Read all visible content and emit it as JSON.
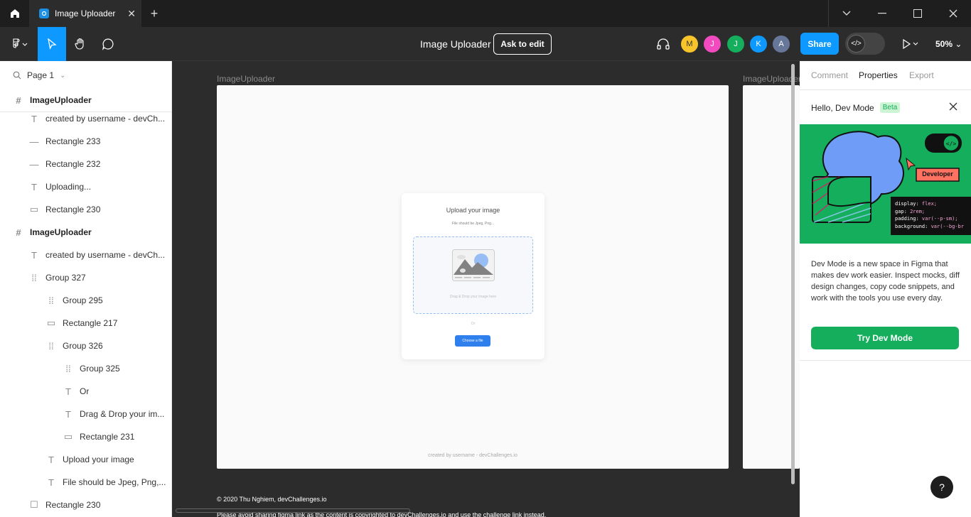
{
  "tab": {
    "title": "Image Uploader"
  },
  "toolbar": {
    "doc_title": "Image Uploader",
    "ask_edit_label": "Ask to edit",
    "avatars": [
      {
        "initial": "M",
        "color": "#f7c42b"
      },
      {
        "initial": "J",
        "color": "#f24abf"
      },
      {
        "initial": "J",
        "color": "#14ae5c"
      },
      {
        "initial": "K",
        "color": "#0d99ff"
      },
      {
        "initial": "A",
        "color": "#667799"
      }
    ],
    "share_label": "Share",
    "zoom": "50%"
  },
  "layers": {
    "page": "Page 1",
    "items": [
      {
        "label": "ImageUploader",
        "icon": "frame-icon"
      },
      {
        "label": "created by username - devCh...",
        "icon": "text-icon"
      },
      {
        "label": "Rectangle 233",
        "icon": "line-icon"
      },
      {
        "label": "Rectangle 232",
        "icon": "line-icon"
      },
      {
        "label": "Uploading...",
        "icon": "text-icon"
      },
      {
        "label": "Rectangle 230",
        "icon": "rectangle-icon"
      },
      {
        "label": "ImageUploader",
        "icon": "frame-icon"
      },
      {
        "label": "created by username - devCh...",
        "icon": "text-icon"
      },
      {
        "label": "Group 327",
        "icon": "group-icon"
      },
      {
        "label": "Group 295",
        "icon": "group-icon"
      },
      {
        "label": "Rectangle 217",
        "icon": "rectangle-icon"
      },
      {
        "label": "Group 326",
        "icon": "group-icon"
      },
      {
        "label": "Group 325",
        "icon": "group-icon"
      },
      {
        "label": "Or",
        "icon": "text-icon"
      },
      {
        "label": "Drag & Drop your im...",
        "icon": "text-icon"
      },
      {
        "label": "Rectangle 231",
        "icon": "rectangle-icon"
      },
      {
        "label": "Upload your image",
        "icon": "text-icon"
      },
      {
        "label": "File should be Jpeg, Png,...",
        "icon": "text-icon"
      },
      {
        "label": "Rectangle 230",
        "icon": "rectangle-icon"
      }
    ]
  },
  "canvas": {
    "frame_label": "ImageUploader",
    "frame_label_2": "ImageUploader",
    "card_title": "Upload your image",
    "card_subtitle": "File should be Jpeg, Png...",
    "dropzone_text": "Drag & Drop your image here",
    "or_text": "Or",
    "choose_label": "Choose a file",
    "footer": "created by username - devChallenges.io",
    "copyright": "© 2020 Thu Nghiem, devChallenges.io",
    "warning": "Please avoid sharing figma link as the content is copyrighted to devChallenges.io and use the challenge link instead."
  },
  "right_panel": {
    "tabs": [
      "Comment",
      "Properties",
      "Export"
    ],
    "dev_heading": "Hello, Dev Mode",
    "beta": "Beta",
    "promo_badge": "Developer",
    "code_lines": [
      {
        "prop": "display:",
        "val": " flex;"
      },
      {
        "prop": "gap:",
        "val": " 2rem;"
      },
      {
        "prop": "padding:",
        "val": " var(--p-sm);"
      },
      {
        "prop": "background:",
        "val": " var(--bg-br"
      }
    ],
    "description": "Dev Mode is a new space in Figma that makes dev work easier. Inspect mocks, diff design changes, copy code snippets, and work with the tools you use every day.",
    "try_label": "Try Dev Mode",
    "help": "?"
  },
  "colors": {
    "accent": "#0d99ff",
    "dev_green": "#14ae5c",
    "upload_blue": "#2f80ed"
  }
}
